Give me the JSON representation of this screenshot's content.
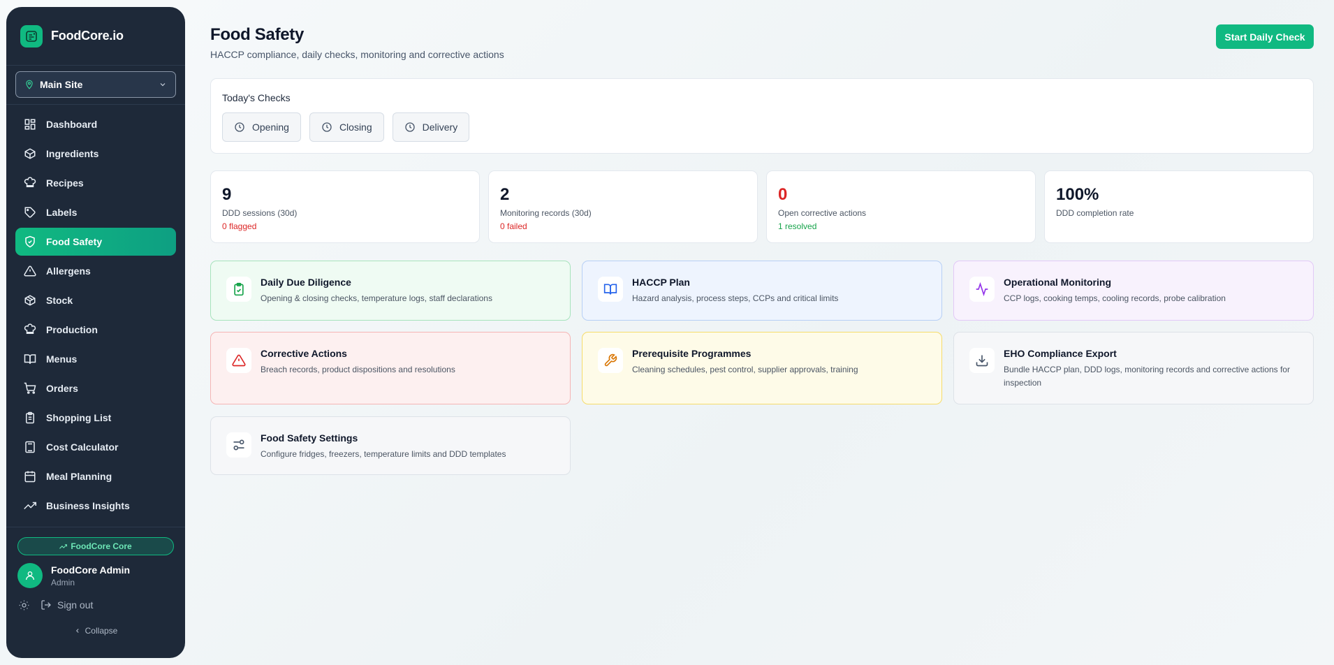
{
  "app": {
    "name": "FoodCore.io"
  },
  "site": {
    "selected": "Main Site"
  },
  "nav": [
    {
      "label": "Dashboard",
      "icon": "grid-icon"
    },
    {
      "label": "Ingredients",
      "icon": "package-icon"
    },
    {
      "label": "Recipes",
      "icon": "chef-hat-icon"
    },
    {
      "label": "Labels",
      "icon": "tag-icon"
    },
    {
      "label": "Food Safety",
      "icon": "shield-check-icon",
      "active": true
    },
    {
      "label": "Allergens",
      "icon": "warning-triangle-icon"
    },
    {
      "label": "Stock",
      "icon": "box-icon"
    },
    {
      "label": "Production",
      "icon": "chef-hat-icon"
    },
    {
      "label": "Menus",
      "icon": "book-open-icon"
    },
    {
      "label": "Orders",
      "icon": "cart-icon"
    },
    {
      "label": "Shopping List",
      "icon": "clipboard-list-icon"
    },
    {
      "label": "Cost Calculator",
      "icon": "calculator-icon"
    },
    {
      "label": "Meal Planning",
      "icon": "calendar-icon"
    },
    {
      "label": "Business Insights",
      "icon": "trending-up-icon"
    }
  ],
  "sidebar_footer": {
    "plan": "FoodCore Core",
    "user_name": "FoodCore Admin",
    "user_role": "Admin",
    "sign_out": "Sign out",
    "collapse": "Collapse"
  },
  "page": {
    "title": "Food Safety",
    "subtitle": "HACCP compliance, daily checks, monitoring and corrective actions",
    "primary_action": "Start Daily Check"
  },
  "todays_checks": {
    "title": "Today's Checks",
    "items": [
      "Opening",
      "Closing",
      "Delivery"
    ]
  },
  "stats": [
    {
      "value": "9",
      "label": "DDD sessions (30d)",
      "sub": "0 flagged",
      "sub_color": "red"
    },
    {
      "value": "2",
      "label": "Monitoring records (30d)",
      "sub": "0 failed",
      "sub_color": "red"
    },
    {
      "value": "0",
      "label": "Open corrective actions",
      "sub": "1 resolved",
      "sub_color": "green",
      "value_color": "red"
    },
    {
      "value": "100%",
      "label": "DDD completion rate"
    }
  ],
  "features": [
    {
      "title": "Daily Due Diligence",
      "desc": "Opening & closing checks, temperature logs, staff declarations",
      "icon": "clipboard-check-icon"
    },
    {
      "title": "HACCP Plan",
      "desc": "Hazard analysis, process steps, CCPs and critical limits",
      "icon": "book-open-icon"
    },
    {
      "title": "Operational Monitoring",
      "desc": "CCP logs, cooking temps, cooling records, probe calibration",
      "icon": "activity-icon"
    },
    {
      "title": "Corrective Actions",
      "desc": "Breach records, product dispositions and resolutions",
      "icon": "warning-triangle-icon"
    },
    {
      "title": "Prerequisite Programmes",
      "desc": "Cleaning schedules, pest control, supplier approvals, training",
      "icon": "wrench-icon"
    },
    {
      "title": "EHO Compliance Export",
      "desc": "Bundle HACCP plan, DDD logs, monitoring records and corrective actions for inspection",
      "icon": "download-icon"
    },
    {
      "title": "Food Safety Settings",
      "desc": "Configure fridges, freezers, temperature limits and DDD templates",
      "icon": "sliders-icon"
    }
  ],
  "colors": {
    "accent": "#10b981",
    "sidebar_bg": "#1e2939",
    "danger": "#dc2626",
    "success": "#16a34a"
  }
}
